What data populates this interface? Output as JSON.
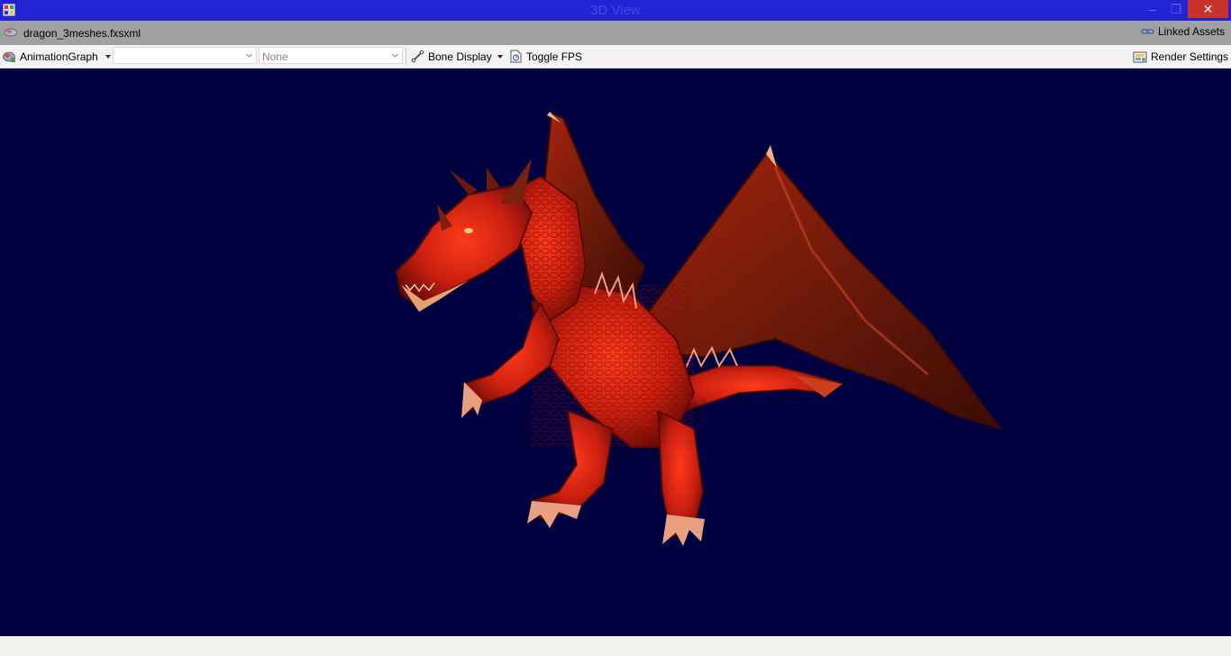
{
  "window": {
    "title": "3D View",
    "controls": {
      "minimize": "–",
      "maximize": "❐",
      "close": "✕"
    }
  },
  "assetbar": {
    "file_label": "dragon_3meshes.fxsxml",
    "file_icon": "mesh-file-icon",
    "linked_assets_label": "Linked Assets",
    "linked_icon": "link-icon"
  },
  "toolbar": {
    "animation_graph_label": "AnimationGraph",
    "animation_graph_icon": "animation-graph-icon",
    "combo1_value": "",
    "combo2_value": "None",
    "bone_display_label": "Bone Display",
    "bone_icon": "bone-icon",
    "toggle_fps_label": "Toggle FPS",
    "fps_icon": "fps-icon",
    "render_settings_label": "Render Settings",
    "render_settings_icon": "render-settings-icon"
  },
  "viewport": {
    "background": "#00003f",
    "model": "red dragon"
  },
  "colors": {
    "titlebar": "#2323d6",
    "assetbar": "#a0a0a0",
    "toolbar": "#f4f4f4",
    "close": "#c7332b"
  }
}
